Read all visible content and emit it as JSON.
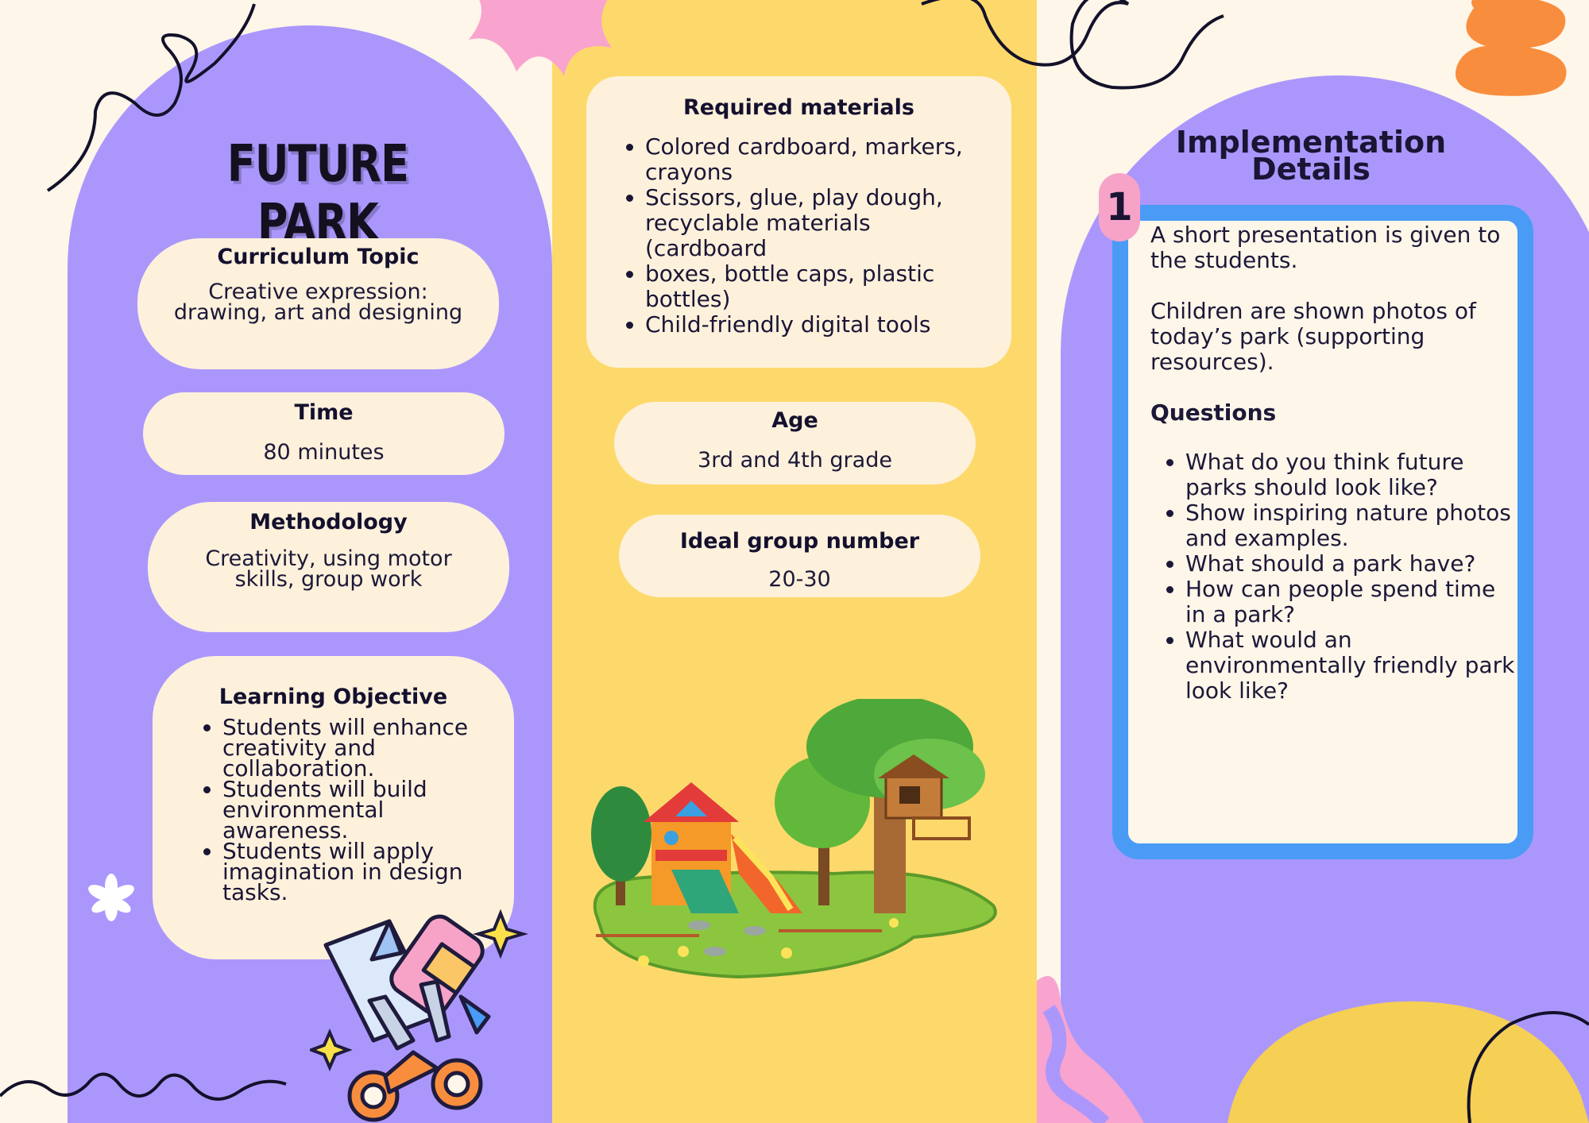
{
  "title": "FUTURE PARK",
  "curriculum": {
    "heading": "Curriculum Topic",
    "text": "Creative expression: drawing, art and designing"
  },
  "time": {
    "heading": "Time",
    "text": "80 minutes"
  },
  "methodology": {
    "heading": "Methodology",
    "text": "Creativity, using motor skills, group work"
  },
  "objective": {
    "heading": "Learning Objective",
    "items": [
      "Students will enhance creativity and collaboration.",
      "Students will build environmental awareness.",
      "Students will apply imagination in design tasks."
    ]
  },
  "materials": {
    "heading": "Required materials",
    "items": [
      "Colored cardboard, markers, crayons",
      "Scissors, glue, play dough, recyclable materials (cardboard",
      "boxes, bottle caps, plastic bottles)",
      "Child-friendly digital tools"
    ]
  },
  "age": {
    "heading": "Age",
    "text": "3rd and 4th grade"
  },
  "group": {
    "heading": "Ideal group number",
    "text": "20-30"
  },
  "implementation": {
    "title": "Implementation Details",
    "number": "1",
    "para1": "A short presentation is given to the students.",
    "para2": "Children are shown photos of today’s park (supporting resources).",
    "questions_heading": "Questions",
    "questions": [
      "What do you think future parks should look like?",
      "Show inspiring nature photos and examples.",
      "What should a park have?",
      "How can people spend time in a park?",
      "What would an environmentally friendly park look like?"
    ]
  },
  "colors": {
    "purple": "#ab97fc",
    "yellow": "#fdd96b",
    "cream": "#fdf1dc",
    "blue_frame": "#4a9bf5",
    "pink": "#f7a3c8",
    "orange": "#f98d3e"
  },
  "icons": [
    "scribble-icon",
    "pink-flower-icon",
    "orange-blob-icon",
    "asterisk-icon",
    "scissors-glue-icon",
    "playground-illustration",
    "sparkle-icon"
  ]
}
